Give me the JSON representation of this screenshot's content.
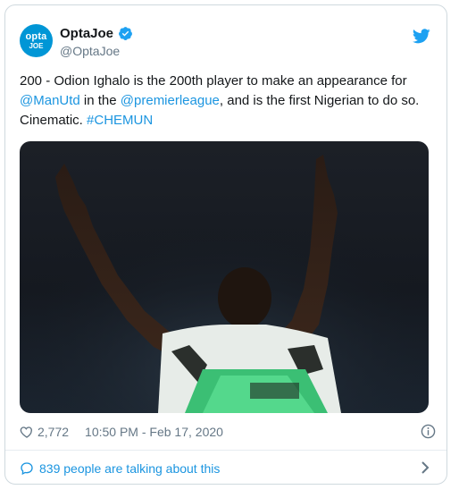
{
  "tweet": {
    "author": {
      "avatar_text_top": "opta",
      "avatar_text_bottom": "JOE",
      "display_name": "OptaJoe",
      "handle": "@OptaJoe",
      "verified_icon": "verified-badge-icon",
      "brand_color": "#0096d6"
    },
    "text_parts": {
      "p1": "200 - Odion Ighalo is the 200th player to make an appearance for ",
      "mention1": "@ManUtd",
      "p2": " in the ",
      "mention2": "@premierleague",
      "p3": ", and is the first Nigerian to do so. Cinematic. ",
      "hashtag": "#CHEMUN"
    },
    "likes": "2,772",
    "timestamp": "10:50 PM - Feb 17, 2020",
    "conversation": "839 people are talking about this",
    "link_color": "#1b95e0"
  }
}
